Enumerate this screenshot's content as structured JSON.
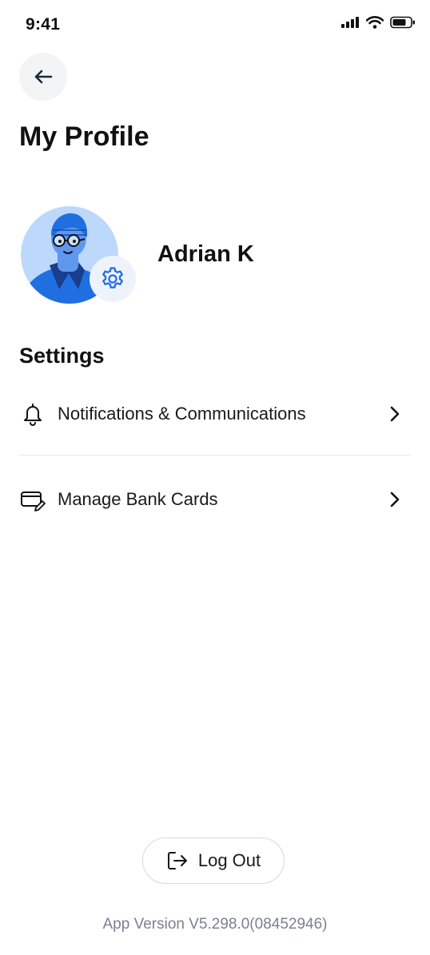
{
  "status_bar": {
    "time": "9:41"
  },
  "header": {
    "title": "My Profile"
  },
  "profile": {
    "name": "Adrian K"
  },
  "settings": {
    "title": "Settings",
    "items": [
      {
        "label": "Notifications & Communications",
        "icon": "bell-icon"
      },
      {
        "label": "Manage Bank Cards",
        "icon": "bank-card-icon"
      }
    ]
  },
  "footer": {
    "logout_label": "Log Out",
    "app_version": "App Version V5.298.0(08452946)"
  },
  "colors": {
    "accent": "#1f6fe0",
    "avatar_bg": "#bcd8fb",
    "text": "#111111",
    "muted": "#7a8190"
  }
}
